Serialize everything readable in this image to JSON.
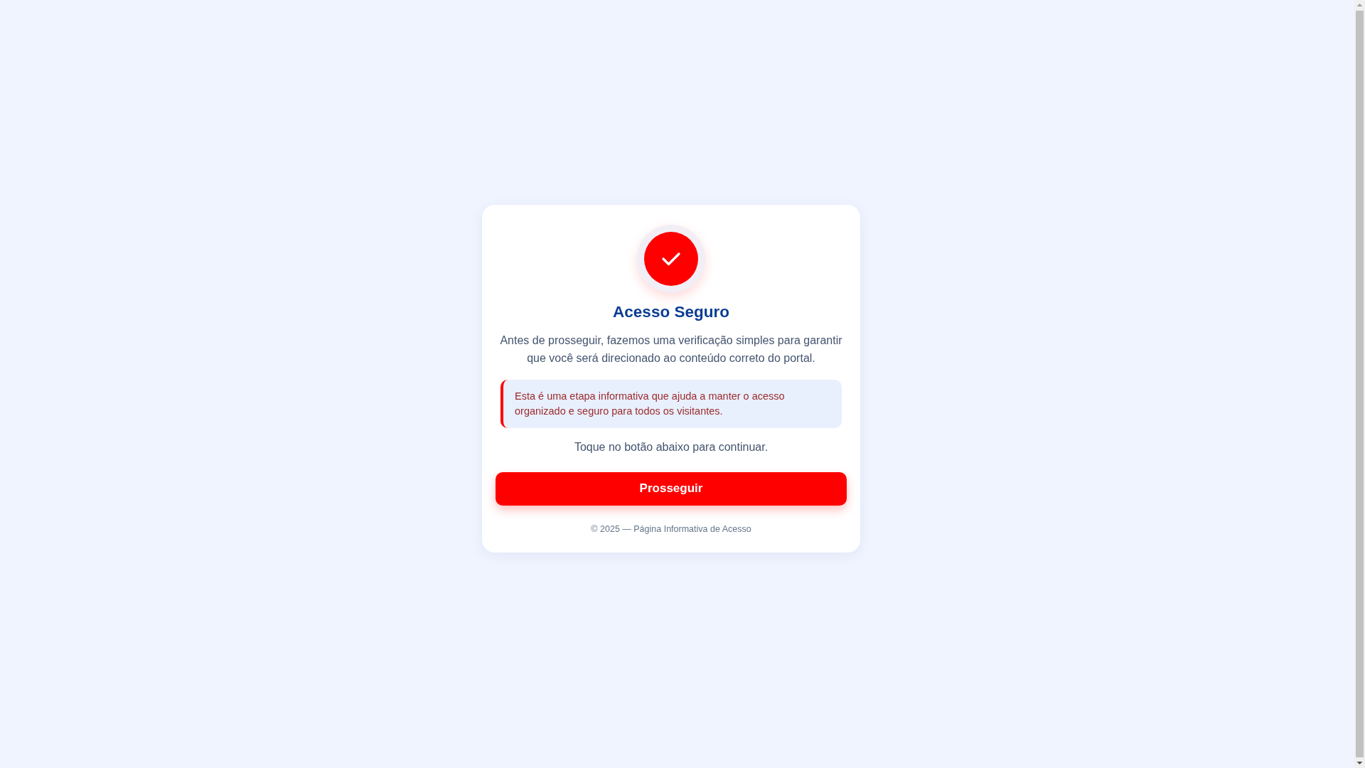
{
  "title": "Acesso Seguro",
  "intro": "Antes de prosseguir, fazemos uma verificação simples para garantir que você será direcionado ao conteúdo correto do portal.",
  "notice": "Esta é uma etapa informativa que ajuda a manter o acesso organizado e seguro para todos os visitantes.",
  "prompt": "Toque no botão abaixo para continuar.",
  "button": "Prosseguir",
  "footer": "© 2025 — Página Informativa de Acesso"
}
